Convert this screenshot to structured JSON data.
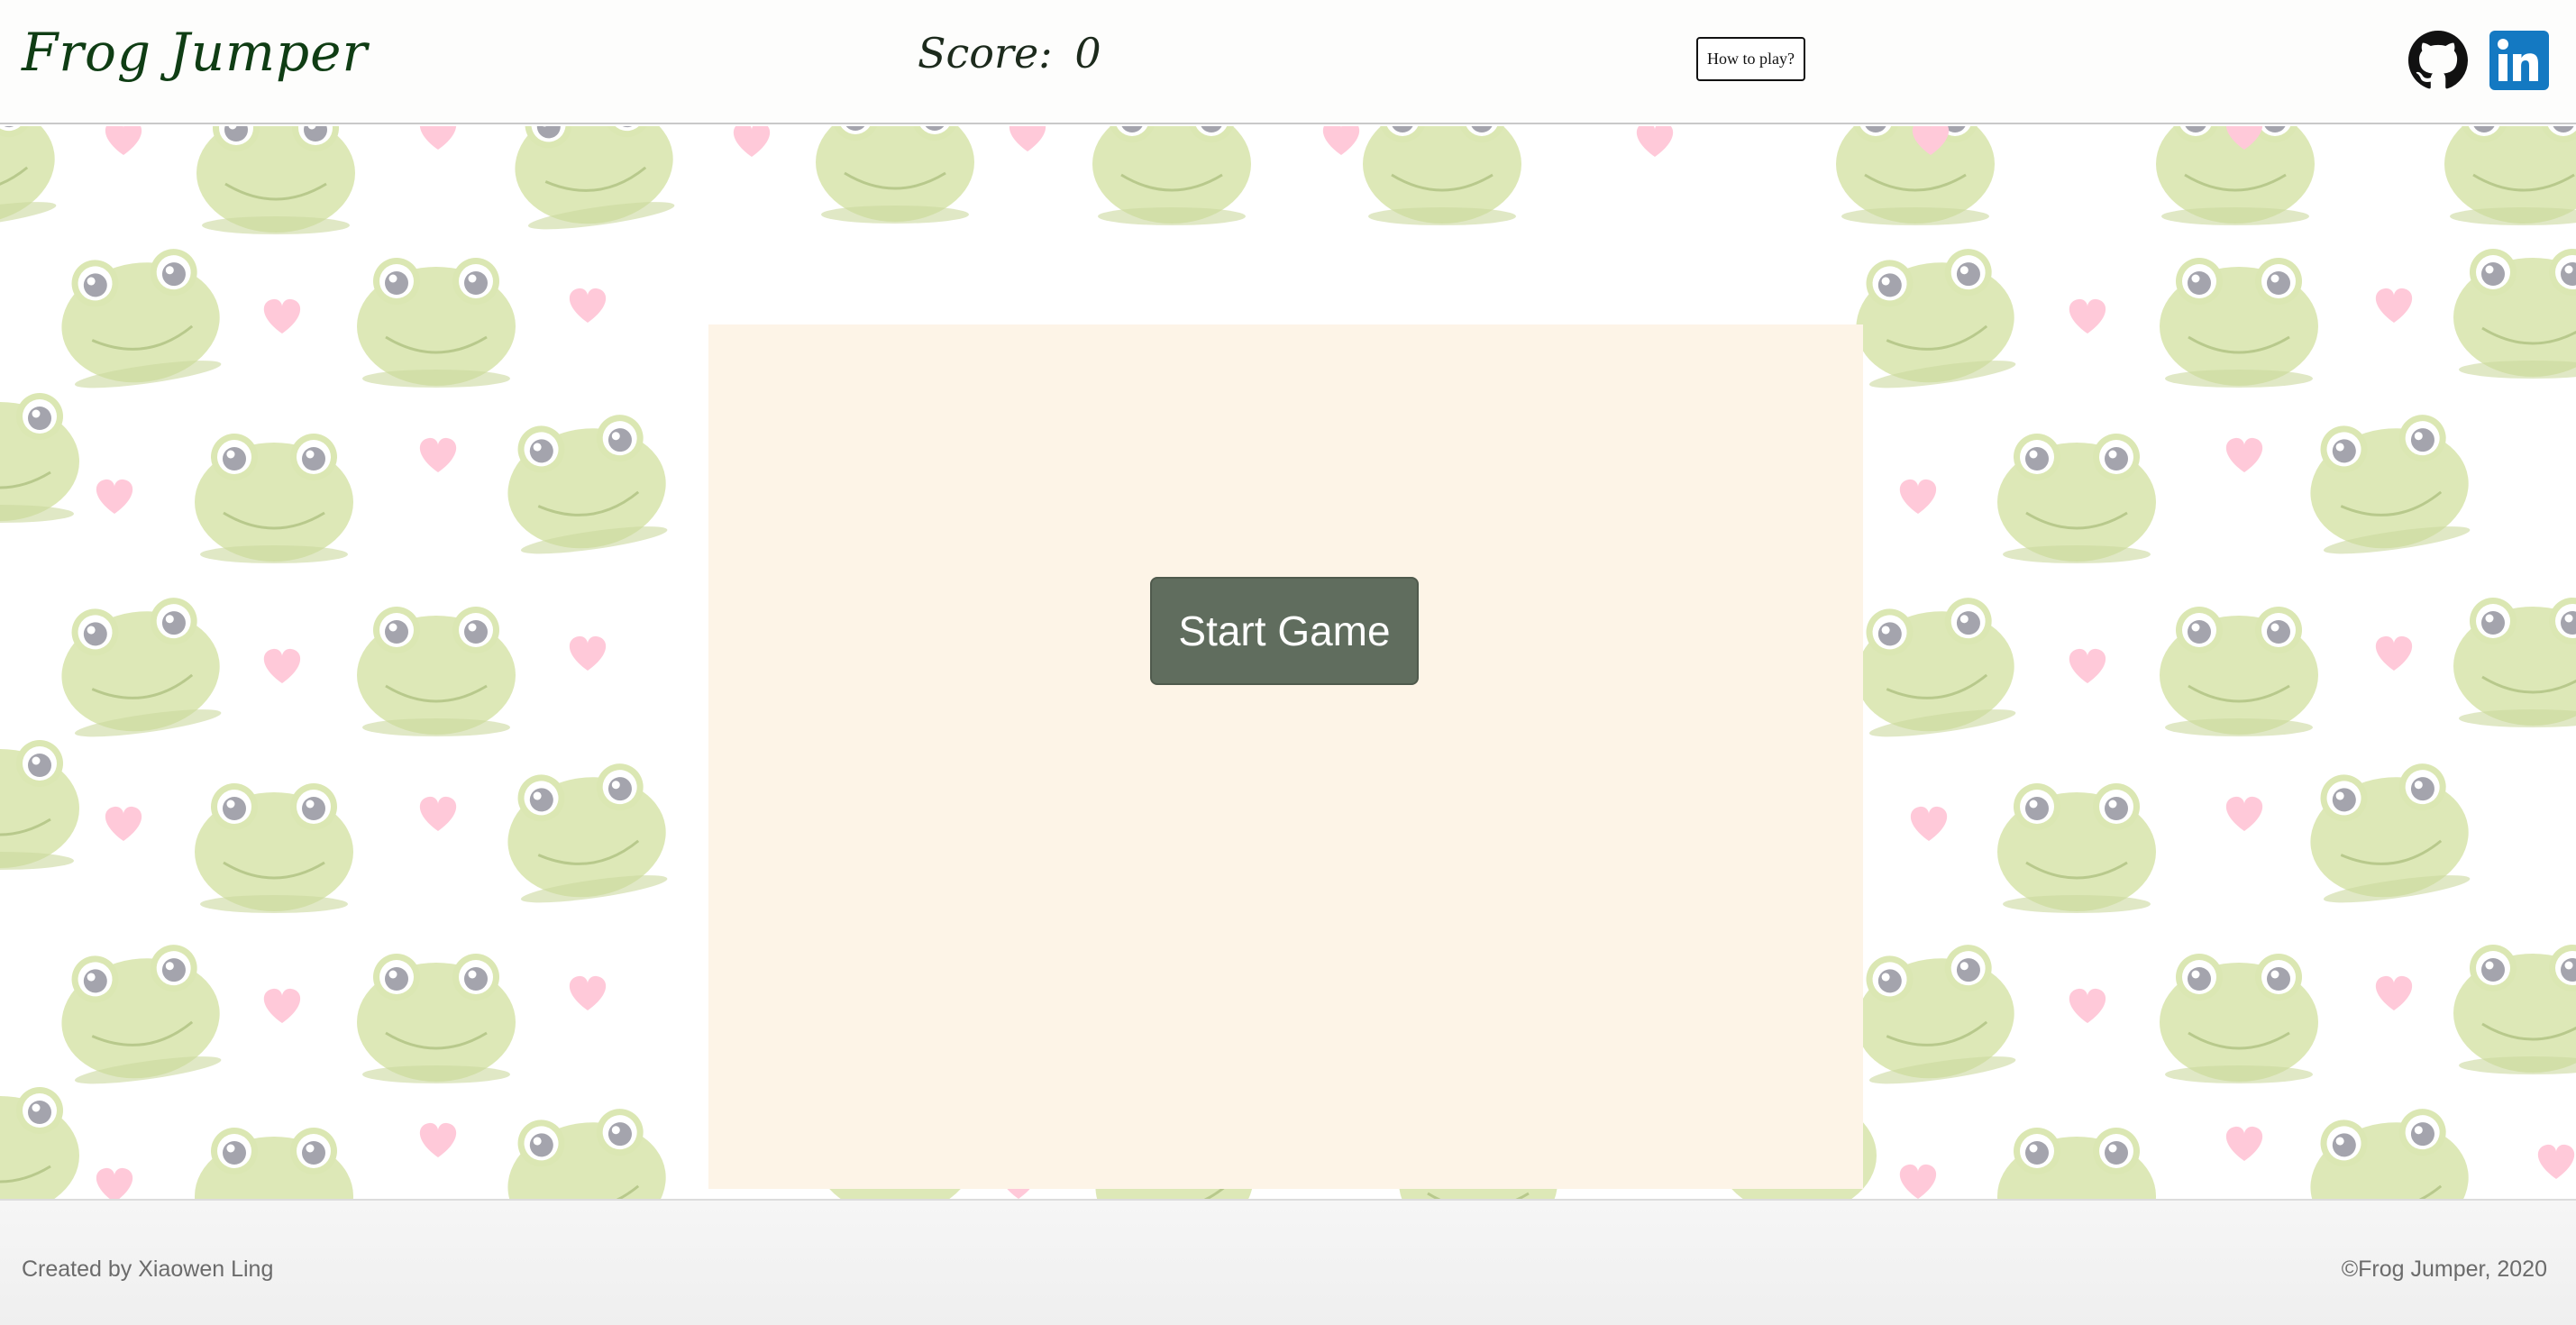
{
  "header": {
    "title": "Frog Jumper",
    "score_label": "Score:",
    "score_value": "0",
    "howto_label": "How to play?",
    "social": [
      {
        "name": "github-icon",
        "color": "#111111"
      },
      {
        "name": "linkedin-icon",
        "color": "#1479c2"
      }
    ]
  },
  "game": {
    "start_label": "Start Game",
    "board_color": "#fdf4e7",
    "button_color": "#606d5e"
  },
  "background": {
    "pattern": [
      "frog-icon",
      "heart-icon"
    ],
    "frog_color": "#dbe7b3",
    "heart_color": "#ffc9d9"
  },
  "footer": {
    "credit": "Created by Xiaowen Ling",
    "copyright": "©Frog Jumper, 2020"
  }
}
